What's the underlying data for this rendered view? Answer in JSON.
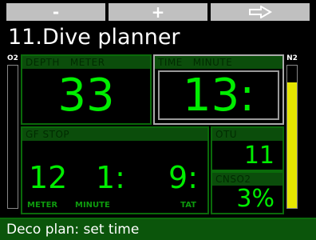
{
  "softkeys": {
    "minus_label": "-",
    "plus_label": "+",
    "next_icon": "right-arrow-icon"
  },
  "title": "11.Dive planner",
  "o2_bar": {
    "label": "O2",
    "level": 0.0
  },
  "n2_bar": {
    "label": "N2",
    "level": 0.88,
    "color": "#e5e500"
  },
  "depth": {
    "header_label": "DEPTH",
    "header_unit": "METER",
    "value": "33"
  },
  "time": {
    "header_label": "TIME",
    "header_unit": "MINUTE",
    "value": "13:"
  },
  "gf_stop": {
    "header_label": "GF STOP",
    "depth_value": "12",
    "time_value": "1:",
    "tat_value": "9:",
    "depth_unit": "METER",
    "time_unit": "MINUTE",
    "tat_label": "TAT"
  },
  "otu": {
    "header_label": "OTU",
    "value": "11"
  },
  "cnso2": {
    "header_label": "CNSO2",
    "value": "3%"
  },
  "status_text": "Deco plan: set time",
  "colors": {
    "value_green": "#00ee00",
    "header_green": "#0b4d0b",
    "status_bg": "#0b550b",
    "softkey_bg": "#c0c0c0"
  }
}
